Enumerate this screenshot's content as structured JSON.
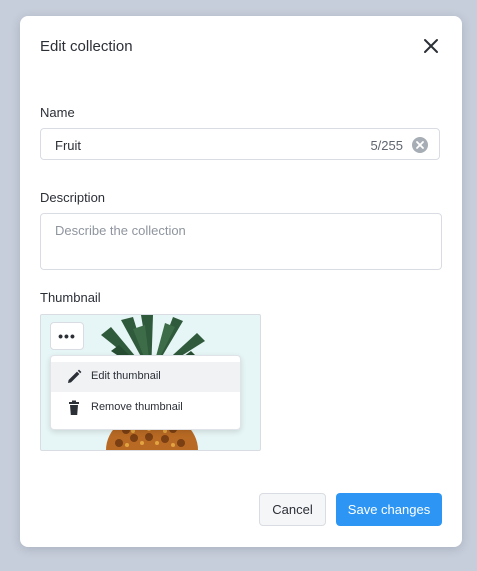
{
  "dialog": {
    "title": "Edit collection"
  },
  "name": {
    "label": "Name",
    "value": "Fruit",
    "char_count": "5/255"
  },
  "description": {
    "label": "Description",
    "placeholder": "Describe the collection",
    "value": ""
  },
  "thumbnail": {
    "label": "Thumbnail",
    "more_label": "•••",
    "menu": [
      {
        "label": "Edit thumbnail",
        "icon": "pencil-icon"
      },
      {
        "label": "Remove thumbnail",
        "icon": "trash-icon"
      }
    ]
  },
  "actions": {
    "cancel": "Cancel",
    "save": "Save changes"
  },
  "colors": {
    "primary": "#2d96f4",
    "backdrop": "#c7cedb",
    "thumbnail_bg": "#e6f5f5"
  }
}
